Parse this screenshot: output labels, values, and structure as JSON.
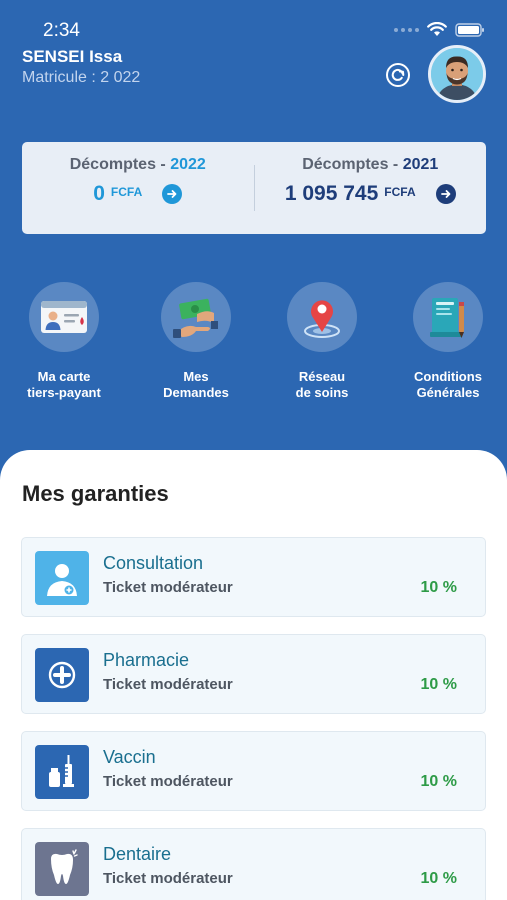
{
  "status_bar": {
    "time": "2:34"
  },
  "user": {
    "name": "SENSEI Issa",
    "matricule": "Matricule : 2 022"
  },
  "summary": [
    {
      "label_prefix": "Décomptes - ",
      "year": "2022",
      "amount": "0",
      "currency": "FCFA",
      "accent": "#1f97d8"
    },
    {
      "label_prefix": "Décomptes - ",
      "year": "2021",
      "amount": "1 095 745",
      "currency": "FCFA",
      "accent": "#1e3d7a"
    }
  ],
  "quick_actions": [
    {
      "line1": "Ma carte",
      "line2": "tiers-payant",
      "icon": "id-card-icon"
    },
    {
      "line1": "Mes",
      "line2": "Demandes",
      "icon": "money-hand-icon"
    },
    {
      "line1": "Réseau",
      "line2": "de soins",
      "icon": "map-pin-icon"
    },
    {
      "line1": "Conditions",
      "line2": "Générales",
      "icon": "document-pen-icon"
    }
  ],
  "guarantees_title": "Mes garanties",
  "guarantees": [
    {
      "title": "Consultation",
      "subtitle": "Ticket modérateur",
      "percent": "10 %",
      "icon": "doctor-icon",
      "icon_color": "#4fb3e8"
    },
    {
      "title": "Pharmacie",
      "subtitle": "Ticket modérateur",
      "percent": "10 %",
      "icon": "medical-cross-icon",
      "icon_color": "#2c67b2"
    },
    {
      "title": "Vaccin",
      "subtitle": "Ticket modérateur",
      "percent": "10 %",
      "icon": "syringe-icon",
      "icon_color": "#2c67b2"
    },
    {
      "title": "Dentaire",
      "subtitle": "Ticket modérateur",
      "percent": "10 %",
      "icon": "tooth-icon",
      "icon_color": "#6d7590"
    }
  ],
  "colors": {
    "primary": "#2c67b2",
    "success": "#2e9b47",
    "accent_light": "#1f97d8"
  }
}
